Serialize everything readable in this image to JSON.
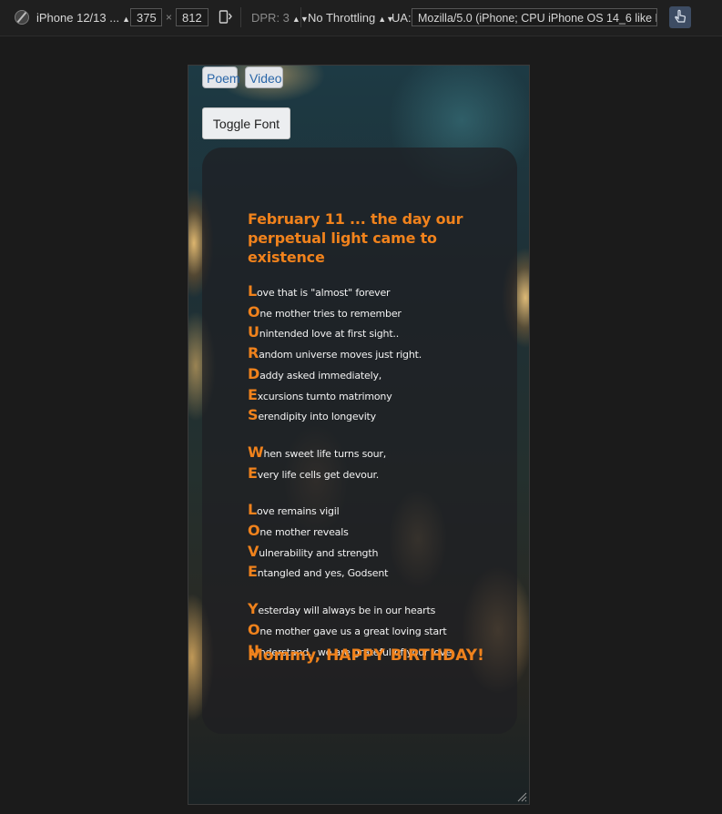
{
  "devtools": {
    "device": "iPhone 12/13 ...",
    "width": "375",
    "times": "×",
    "height": "812",
    "dpr": "DPR: 3",
    "throttling": "No Throttling",
    "ua_label": "UA:",
    "ua": "Mozilla/5.0 (iPhone; CPU iPhone OS 14_6 like Mac"
  },
  "nav": {
    "poem_label": "Poem",
    "video_label": "Video"
  },
  "toggle_font_label": "Toggle Font",
  "poem": {
    "title": "February 11 ... the day our perpetual light came to existence",
    "stanzas": [
      [
        {
          "cap": "L",
          "rest": "ove that is \"almost\" forever"
        },
        {
          "cap": "O",
          "rest": "ne mother tries to remember"
        },
        {
          "cap": "U",
          "rest": "nintended love at first sight.."
        },
        {
          "cap": "R",
          "rest": "andom universe moves just right."
        },
        {
          "cap": "D",
          "rest": "addy asked immediately,"
        },
        {
          "cap": "E",
          "rest": "xcursions turnto matrimony"
        },
        {
          "cap": "S",
          "rest": "erendipity into longevity"
        }
      ],
      [
        {
          "cap": "W",
          "rest": "hen sweet life turns sour,"
        },
        {
          "cap": "E",
          "rest": "very life cells get devour."
        }
      ],
      [
        {
          "cap": "L",
          "rest": "ove remains vigil"
        },
        {
          "cap": "O",
          "rest": "ne mother reveals"
        },
        {
          "cap": "V",
          "rest": "ulnerability and strength"
        },
        {
          "cap": "E",
          "rest": "ntangled and yes, Godsent"
        }
      ],
      [
        {
          "cap": "Y",
          "rest": "esterday will always be in our hearts"
        },
        {
          "cap": "O",
          "rest": "ne mother gave us a great loving start"
        },
        {
          "cap": "U",
          "rest": "nderstand.. we are grateful of your love"
        }
      ]
    ],
    "closing": "Mommy, HAPPY BIRTHDAY!"
  }
}
